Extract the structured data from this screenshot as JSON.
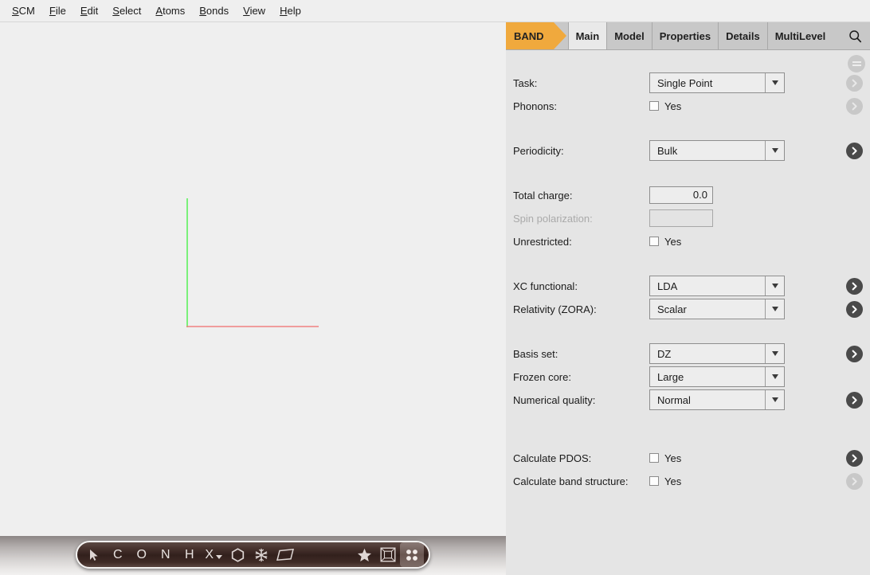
{
  "menubar": {
    "items": [
      {
        "label": "SCM",
        "mnemonic": "S"
      },
      {
        "label": "File",
        "mnemonic": "F"
      },
      {
        "label": "Edit",
        "mnemonic": "E"
      },
      {
        "label": "Select",
        "mnemonic": "S"
      },
      {
        "label": "Atoms",
        "mnemonic": "A"
      },
      {
        "label": "Bonds",
        "mnemonic": "B"
      },
      {
        "label": "View",
        "mnemonic": "V"
      },
      {
        "label": "Help",
        "mnemonic": "H"
      }
    ]
  },
  "panel": {
    "module_tab": "BAND",
    "tabs": [
      {
        "label": "Main",
        "active": true
      },
      {
        "label": "Model",
        "active": false
      },
      {
        "label": "Properties",
        "active": false
      },
      {
        "label": "Details",
        "active": false
      },
      {
        "label": "MultiLevel",
        "active": false
      }
    ],
    "search_icon": "search-icon",
    "menu_icon": "hamburger-icon",
    "accent_color": "#f0a93d"
  },
  "form": {
    "task": {
      "label": "Task:",
      "value": "Single Point",
      "chevron": "disabled"
    },
    "phonons": {
      "label": "Phonons:",
      "checkbox_label": "Yes",
      "checked": false,
      "chevron": "disabled"
    },
    "periodicity": {
      "label": "Periodicity:",
      "value": "Bulk",
      "chevron": "enabled"
    },
    "total_charge": {
      "label": "Total charge:",
      "value": "0.0"
    },
    "spin_polarization": {
      "label": "Spin polarization:",
      "value": "",
      "disabled": true
    },
    "unrestricted": {
      "label": "Unrestricted:",
      "checkbox_label": "Yes",
      "checked": false
    },
    "xc_functional": {
      "label": "XC functional:",
      "value": "LDA",
      "chevron": "enabled"
    },
    "relativity": {
      "label": "Relativity (ZORA):",
      "value": "Scalar",
      "chevron": "enabled"
    },
    "basis_set": {
      "label": "Basis set:",
      "value": "DZ",
      "chevron": "enabled"
    },
    "frozen_core": {
      "label": "Frozen core:",
      "value": "Large",
      "chevron": "none"
    },
    "numerical_quality": {
      "label": "Numerical quality:",
      "value": "Normal",
      "chevron": "enabled"
    },
    "calculate_pdos": {
      "label": "Calculate PDOS:",
      "checkbox_label": "Yes",
      "checked": false,
      "chevron": "enabled"
    },
    "calculate_band_structure": {
      "label": "Calculate band structure:",
      "checkbox_label": "Yes",
      "checked": false,
      "chevron": "disabled"
    }
  },
  "viewport": {
    "axes": {
      "x_axis_color": "#f08080",
      "y_axis_color": "#5cf05c"
    }
  },
  "toolbar": {
    "buttons": [
      {
        "name": "select-tool",
        "glyph": "cursor",
        "label": "",
        "active": false
      },
      {
        "name": "carbon-tool",
        "glyph": "letter",
        "label": "C",
        "active": false
      },
      {
        "name": "oxygen-tool",
        "glyph": "letter",
        "label": "O",
        "active": false
      },
      {
        "name": "nitrogen-tool",
        "glyph": "letter",
        "label": "N",
        "active": false
      },
      {
        "name": "hydrogen-tool",
        "glyph": "letter",
        "label": "H",
        "active": false
      },
      {
        "name": "element-tool",
        "glyph": "letter-menu",
        "label": "X",
        "active": false
      },
      {
        "name": "ring-tool",
        "glyph": "hexagon",
        "label": "",
        "active": false
      },
      {
        "name": "fragment-tool",
        "glyph": "snowflake",
        "label": "",
        "active": false
      },
      {
        "name": "plane-tool",
        "glyph": "parallelogram",
        "label": "",
        "active": false
      }
    ],
    "right_buttons": [
      {
        "name": "favorites-tool",
        "glyph": "star",
        "label": "",
        "active": false
      },
      {
        "name": "unit-cell-tool",
        "glyph": "framed-box",
        "label": "",
        "active": false
      },
      {
        "name": "atom-view-tool",
        "glyph": "four-dots",
        "label": "",
        "active": true
      }
    ]
  }
}
